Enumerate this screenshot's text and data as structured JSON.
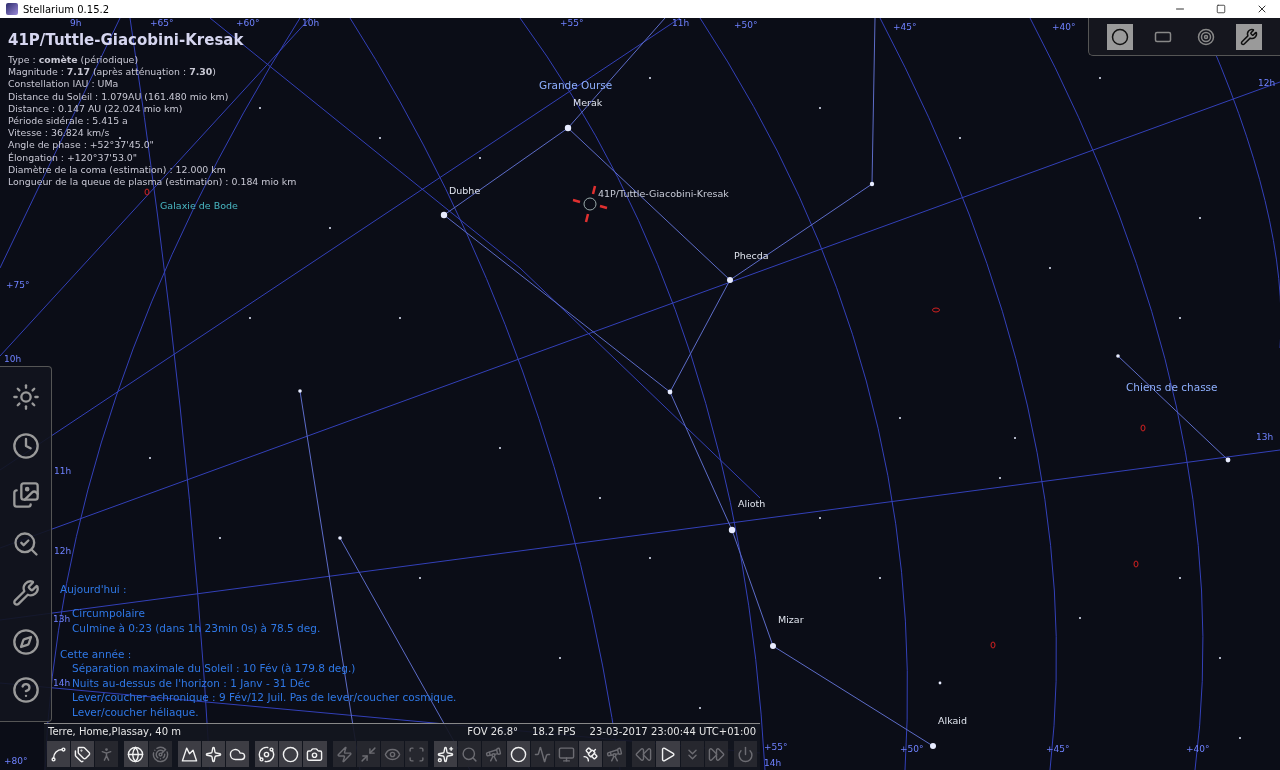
{
  "window": {
    "title": "Stellarium 0.15.2"
  },
  "info": {
    "title": "41P/Tuttle-Giacobini-Kresak",
    "lines": [
      "Type : **comète** (périodique)",
      "Magnitude : **7.17** (après atténuation : **7.30**)",
      "Constellation IAU : UMa",
      "Distance du Soleil : 1.079AU (161.480 mio km)",
      "Distance : 0.147 AU (22.024 mio km)",
      "Période sidérale : 5.415 a",
      "Vitesse : 36.824 km/s",
      "Angle de phase : +52°37'45.0\"",
      "Élongation : +120°37'53.0\"",
      "Diamètre de la coma (estimation) : 12.000 km",
      "Longueur de la queue de plasma (estimation) : 0.184 mio km"
    ]
  },
  "sky": {
    "labels": [
      {
        "kind": "constellation",
        "text": "Grande Ourse"
      },
      {
        "kind": "star",
        "text": "Merak"
      },
      {
        "kind": "star",
        "text": "Dubhe"
      },
      {
        "kind": "comet",
        "text": "41P/Tuttle-Giacobini-Kresak"
      },
      {
        "kind": "star",
        "text": "Phecda"
      },
      {
        "kind": "constellation",
        "text": "Chiens de chasse"
      },
      {
        "kind": "star",
        "text": "Alioth"
      },
      {
        "kind": "star",
        "text": "Mizar"
      },
      {
        "kind": "star",
        "text": "Alkaid"
      },
      {
        "kind": "galaxy",
        "text": "Galaxie de Bode"
      }
    ],
    "grid_labels": [
      "9h",
      "+65°",
      "+60°",
      "10h",
      "+55°",
      "11h",
      "+50°",
      "+45°",
      "+40°",
      "12h",
      "+75°",
      "10h",
      "11h",
      "12h",
      "13h",
      "14h",
      "13h",
      "+80°",
      "+55°",
      "14h",
      "+50°",
      "+45°",
      "+40°"
    ]
  },
  "visibility": {
    "sections": [
      {
        "heading": "Aujourd'hui :",
        "lines": [
          "Circumpolaire",
          "Culmine à 0:23 (dans 1h 23min 0s) à 78.5 deg."
        ]
      },
      {
        "heading": "Cette année :",
        "lines": [
          "Séparation maximale du Soleil : 10 Fév (à 179.8 deg.)",
          "Nuits au-dessus de l'horizon : 1 Janv - 31 Déc",
          "Lever/coucher achronique : 9 Fév/12 Juil. Pas de lever/coucher cosmique.",
          "Lever/coucher héliaque."
        ]
      }
    ]
  },
  "status": {
    "location": "Terre, Home,Plassay, 40 m",
    "fov": "FOV 26.8°",
    "fps": "18.2 FPS",
    "datetime": "23-03-2017 23:00:44 UTC+01:00"
  },
  "toolbar": [
    {
      "on": true
    },
    {
      "on": true
    },
    {
      "on": false
    },
    {
      "on": true
    },
    {
      "on": false
    },
    {
      "on": true
    },
    {
      "on": true
    },
    {
      "on": true
    },
    {
      "on": true
    },
    {
      "on": true
    },
    {
      "on": true
    },
    {
      "on": false
    },
    {
      "on": false
    },
    {
      "on": false
    },
    {
      "on": false
    },
    {
      "on": true
    },
    {
      "on": false
    },
    {
      "on": false
    },
    {
      "on": true
    },
    {
      "on": false
    },
    {
      "on": false
    },
    {
      "on": true
    },
    {
      "on": false
    },
    {
      "on": false
    },
    {
      "on": true
    },
    {
      "on": false
    },
    {
      "on": false
    },
    {
      "on": false
    }
  ],
  "sidebar": [
    {
      "on": false
    },
    {
      "on": false
    },
    {
      "on": false
    },
    {
      "on": false
    },
    {
      "on": false
    },
    {
      "on": false
    },
    {
      "on": false
    }
  ],
  "view_buttons": [
    {
      "on": true
    },
    {
      "on": false
    },
    {
      "on": false
    },
    {
      "on": true
    }
  ]
}
